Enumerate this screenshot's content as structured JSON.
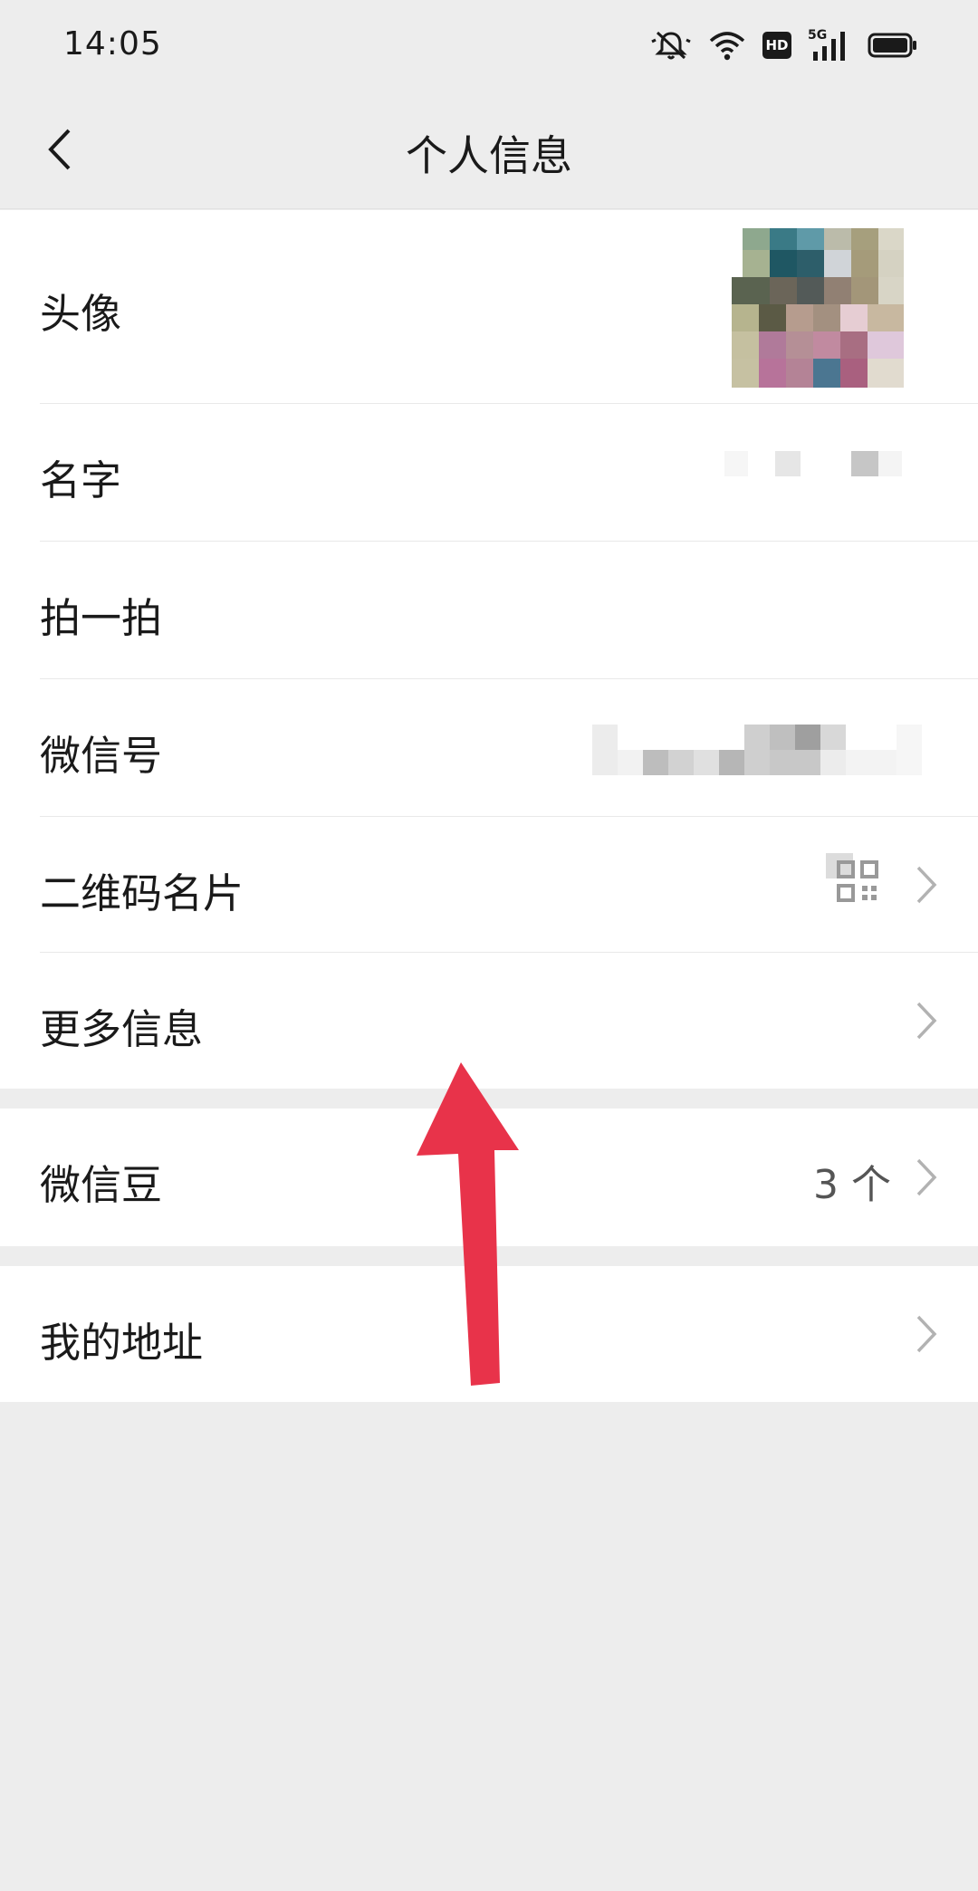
{
  "status_bar": {
    "time": "14:05",
    "icons": [
      "mute-icon",
      "wifi-icon",
      "hd-icon",
      "5g-signal-icon",
      "battery-icon"
    ],
    "hd_label": "HD",
    "network_label": "5G"
  },
  "nav": {
    "title": "个人信息",
    "back_icon": "chevron-left-icon"
  },
  "profile_group": [
    {
      "label": "头像",
      "value_type": "avatar"
    },
    {
      "label": "名字",
      "value_type": "blurred-text"
    },
    {
      "label": "拍一拍",
      "value_type": "none"
    },
    {
      "label": "微信号",
      "value_type": "blurred-text"
    },
    {
      "label": "二维码名片",
      "value_type": "qr-icon"
    },
    {
      "label": "更多信息",
      "value_type": "chevron"
    }
  ],
  "beans_row": {
    "label": "微信豆",
    "value": "3 个"
  },
  "address_row": {
    "label": "我的地址"
  },
  "colors": {
    "background": "#ededed",
    "card": "#ffffff",
    "text": "#1a1a1a",
    "chevron": "#b2b2b2",
    "annotation_arrow": "#e8334a"
  }
}
